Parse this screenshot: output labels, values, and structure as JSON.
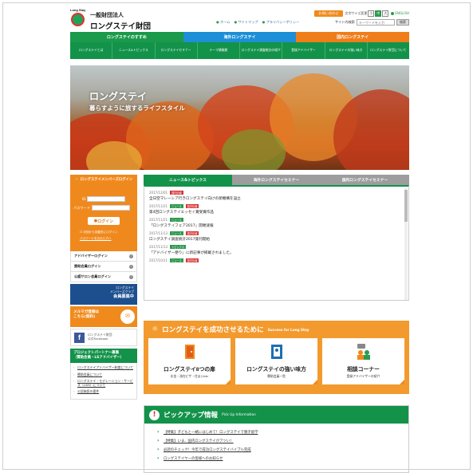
{
  "header": {
    "logo_small": "Long Stay",
    "org_type": "一般財団法人",
    "org_name": "ロングステイ財団",
    "contact_button": "お問い合わせ",
    "font_size_label": "文字サイズ変更",
    "font_sizes": [
      "小",
      "中",
      "大"
    ],
    "english": "ENGLISH",
    "links": [
      "ホーム",
      "サイトマップ",
      "プライバシーポリシー"
    ],
    "search_label": "サイト内検索",
    "search_placeholder": "キーワードを入力",
    "search_button": "検索"
  },
  "main_tabs": [
    "ロングステイのすすめ",
    "海外ロングステイ",
    "国内ロングステイ"
  ],
  "sub_nav": [
    "ロングステイとは",
    "ニュース&トピックス",
    "ロングステイセミナー",
    "テーマ情報館",
    "ロングステイ調査統計の紹介",
    "登録アドバイザー",
    "ロングステイの強い味方",
    "ロングステイ財団について"
  ],
  "hero": {
    "title": "ロングステイ",
    "subtitle": "暮らすように旅するライフスタイル"
  },
  "sidebar": {
    "login_title": "ロングステイメンバーズログイン",
    "id_label": "ID",
    "pw_label": "パスワード",
    "login_button": "ログイン",
    "remember": "次回から自動的にログイン",
    "forgot": "パスワードを忘れた方へ",
    "links": [
      "アドバイザーログイン",
      "賛助会員ログイン",
      "公認サロン会員ログイン"
    ],
    "club_line1": "ロングステイ",
    "club_line2": "メンバーズクラブ",
    "club_line3": "会員募集中",
    "mailmag_line1": "メルマガ登録は",
    "mailmag_line2": "こちら(無料)",
    "fb_line1": "ロングステイ財団",
    "fb_line2": "公式Facebook",
    "pp_title": "プロジェクトパートナー募集",
    "pp_sub": "（賛助会員・LSアドバイザー）",
    "pp_items": [
      "ロングステイアドバイザー制度について",
      "賛助会員について",
      "ロングステイ・モデレーション・サービス（LSM）について",
      "公認施設の要件"
    ]
  },
  "news": {
    "tabs": [
      "ニュース&トピックス",
      "海外ロングステイセミナー",
      "国内ロングステイセミナー"
    ],
    "items": [
      {
        "date": "2017/12/01",
        "tags": [
          {
            "t": "国内情報",
            "c": "r"
          }
        ],
        "title": "全日空マレーシア行きロングステイ向けの新機構を設立"
      },
      {
        "date": "2017/11/21",
        "tags": [
          {
            "t": "ニュース",
            "c": "g"
          },
          {
            "t": "国内情報",
            "c": "r"
          }
        ],
        "title": "第4回ロングステイエッセイ賞受賞作品"
      },
      {
        "date": "2017/11/21",
        "tags": [
          {
            "t": "ニュース",
            "c": "g"
          }
        ],
        "title": "「ロングステイフェア2017」開催速報"
      },
      {
        "date": "2017/11/13",
        "tags": [
          {
            "t": "ニュース",
            "c": "g"
          },
          {
            "t": "国内情報",
            "c": "r"
          }
        ],
        "title": "ロングステイ調査統計2017発刊開始"
      },
      {
        "date": "2017/11/13",
        "tags": [
          {
            "t": "トピックス",
            "c": "g"
          }
        ],
        "title": "「アドバイザー便り」に新記事が掲載されました。"
      },
      {
        "date": "2017/10/11",
        "tags": [
          {
            "t": "ニュース",
            "c": "g"
          },
          {
            "t": "国内情報",
            "c": "r"
          }
        ],
        "title": ""
      }
    ]
  },
  "success": {
    "title": "ロングステイを成功させるために",
    "title_en": "Success for Long Stay",
    "cards": [
      {
        "title": "ロングステイ8つの扉",
        "sub": "お金・滞在ビザ・住まいetc"
      },
      {
        "title": "ロングステイの強い味方",
        "sub": "賛助会員一覧"
      },
      {
        "title": "相談コーナー",
        "sub": "登録アドバイザーの紹介"
      }
    ]
  },
  "pickup": {
    "title": "ピックアップ情報",
    "title_en": "Pick Up Information",
    "items": [
      "【特集】子どもと一緒にはじめて！ロングステイで親子留学",
      "【特集】いま、国内ロングステイがアツい！",
      "必読のチェック！今年で成功ロングステイバイブル完成",
      "ロングステイヤーの皆様へのお知らせ"
    ]
  },
  "colors": {
    "green": "#13924a",
    "blue": "#1c8fd6",
    "orange": "#ef7d1a"
  }
}
